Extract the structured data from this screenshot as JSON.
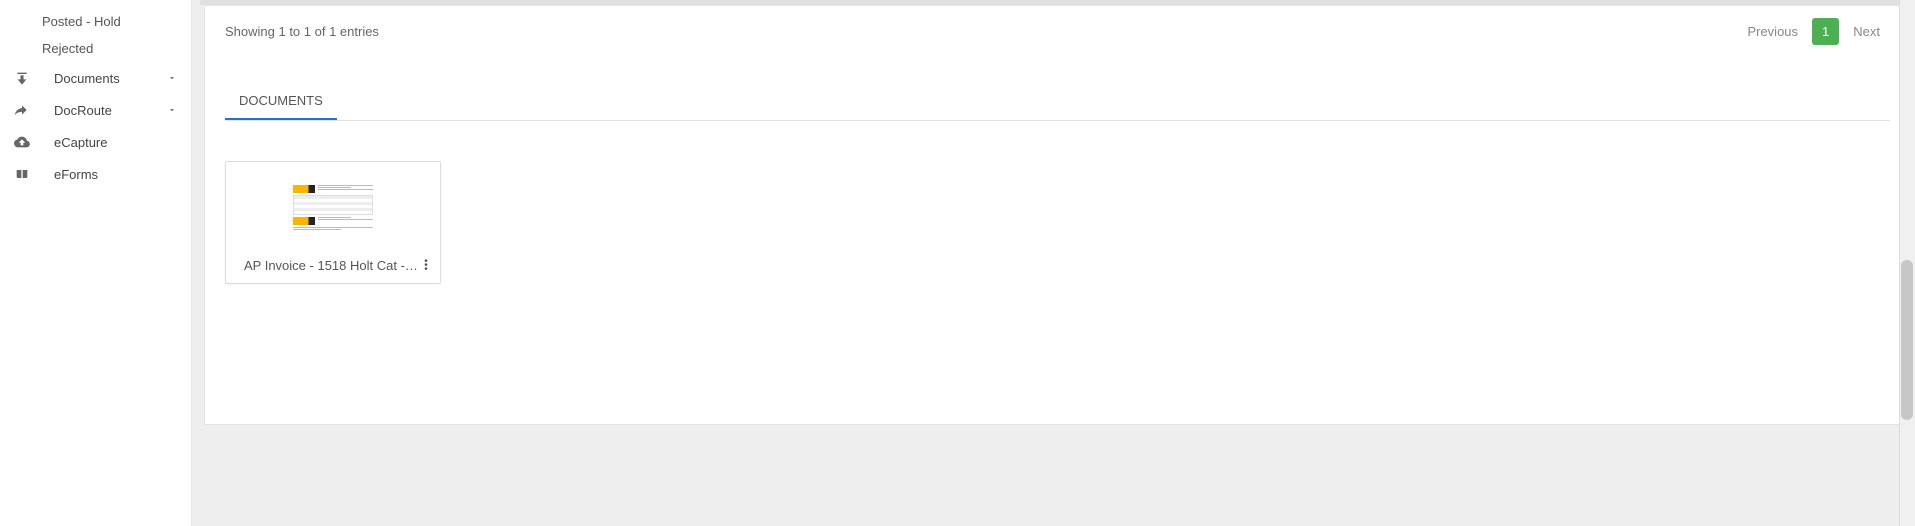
{
  "sidebar": {
    "sub_items": [
      {
        "label": "Posted - Hold"
      },
      {
        "label": "Rejected"
      }
    ],
    "items": [
      {
        "label": "Documents",
        "icon": "download",
        "expandable": true
      },
      {
        "label": "DocRoute",
        "icon": "share",
        "expandable": true
      },
      {
        "label": "eCapture",
        "icon": "cloud-upload",
        "expandable": false
      },
      {
        "label": "eForms",
        "icon": "book",
        "expandable": false
      }
    ]
  },
  "table": {
    "entries_text": "Showing 1 to 1 of 1 entries",
    "prev_label": "Previous",
    "next_label": "Next",
    "current_page": "1"
  },
  "tabs": {
    "documents_label": "DOCUMENTS"
  },
  "documents": [
    {
      "title": "AP Invoice - 1518 Holt Cat -…"
    }
  ]
}
